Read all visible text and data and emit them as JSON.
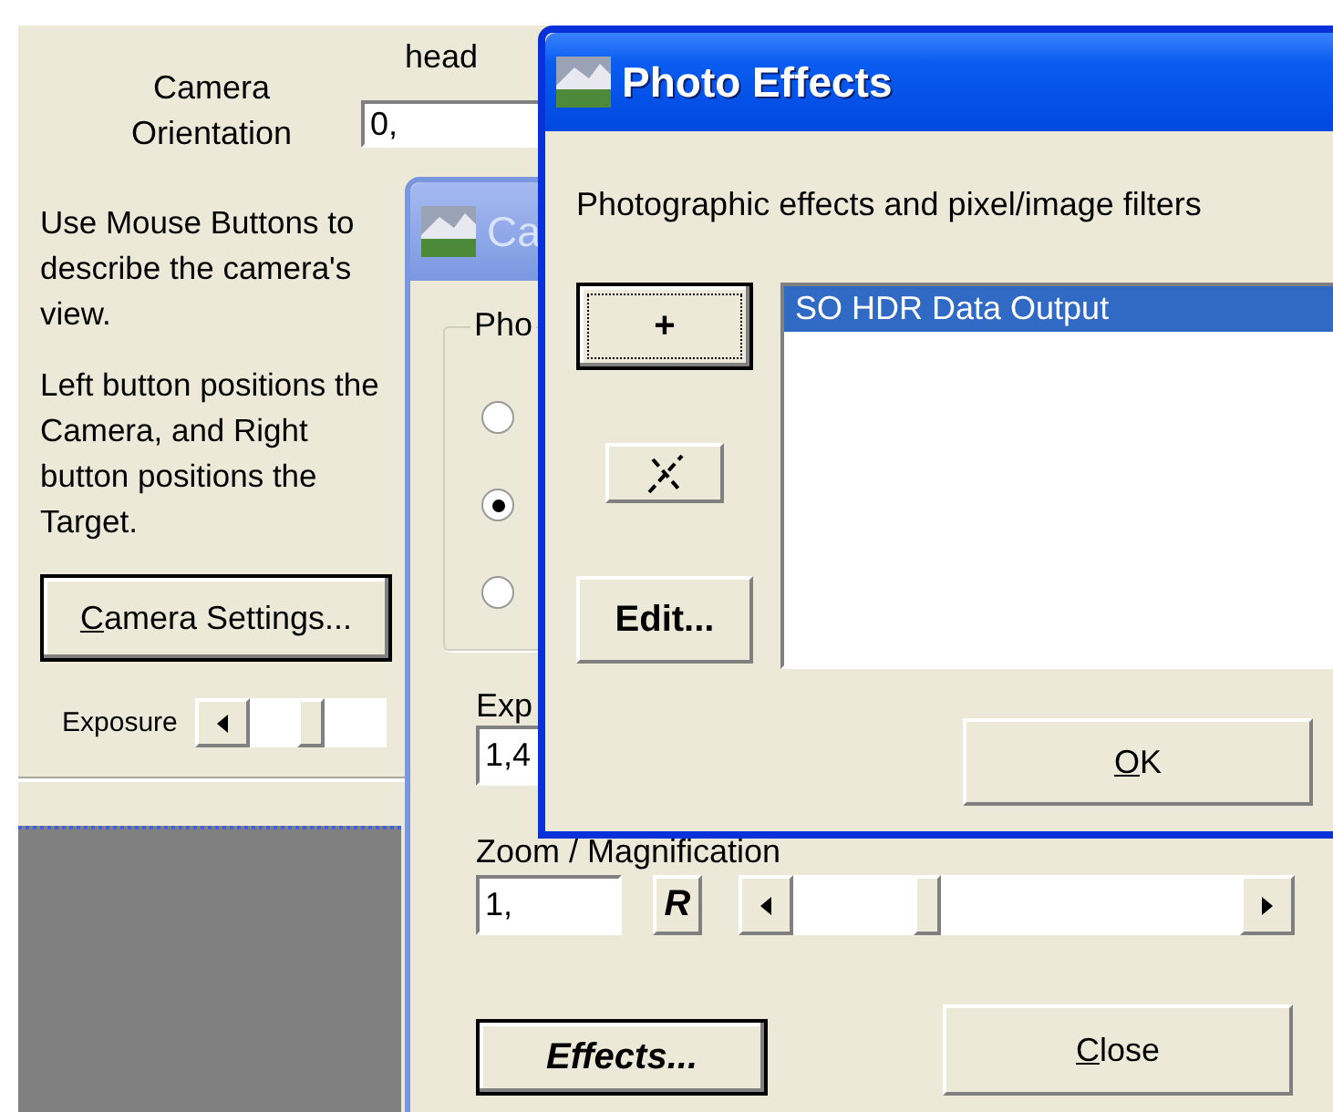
{
  "background_panel": {
    "orientation_label": "Camera Orientation",
    "heading_label": "head",
    "orientation_value": "0,",
    "instructions": [
      "Use Mouse Buttons to describe the camera's view.",
      "Left button positions the Camera, and Right button positions the Target."
    ],
    "camera_settings_button": {
      "label": "Camera Settings...",
      "underline_first": true
    },
    "exposure_label": "Exposure"
  },
  "camera_window": {
    "title": "Ca",
    "group_label": "Pho",
    "radios": [
      {
        "selected": false
      },
      {
        "selected": true
      },
      {
        "selected": false
      }
    ],
    "exposure_label": "Exp",
    "exposure_value": "1,4",
    "zoom_label": "Zoom / Magnification",
    "zoom_value": "1,",
    "reset_button": "R",
    "zoom_slider": {
      "level": 0.3
    },
    "buttons": [
      {
        "label": "Effects...",
        "default": true,
        "underline_first": false
      },
      {
        "label": "Close",
        "default": false,
        "underline_first": true
      }
    ]
  },
  "photo_window": {
    "title": "Photo Effects",
    "description": "Photographic effects and pixel/image filters",
    "side_buttons": [
      {
        "kind": "text",
        "label": "+",
        "focused": true
      },
      {
        "kind": "icon",
        "focused": false
      },
      {
        "kind": "text",
        "label": "Edit...",
        "focused": false
      }
    ],
    "list_items": [
      {
        "label": "SO HDR Data Output",
        "selected": true
      }
    ],
    "ok_button": {
      "label": "OK",
      "underline_first": true
    }
  }
}
